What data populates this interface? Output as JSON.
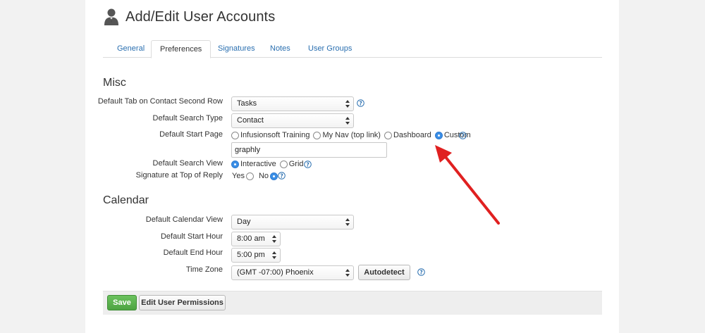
{
  "page": {
    "title": "Add/Edit User Accounts",
    "title_icon": "user-silhouette-icon"
  },
  "tabs": [
    {
      "label": "General",
      "active": false
    },
    {
      "label": "Preferences",
      "active": true
    },
    {
      "label": "Signatures",
      "active": false
    },
    {
      "label": "Notes",
      "active": false
    },
    {
      "label": "User Groups",
      "active": false
    }
  ],
  "misc": {
    "heading": "Misc",
    "default_tab_label": "Default Tab on Contact Second Row",
    "default_tab_value": "Tasks",
    "default_search_type_label": "Default Search Type",
    "default_search_type_value": "Contact",
    "default_start_page_label": "Default Start Page",
    "start_page_options": [
      {
        "label": "Infusionsoft Training",
        "selected": false
      },
      {
        "label": "My Nav (top link)",
        "selected": false
      },
      {
        "label": "Dashboard",
        "selected": false
      },
      {
        "label": "Custom",
        "selected": true
      }
    ],
    "custom_url_value": "graphly",
    "default_search_view_label": "Default Search View",
    "search_view_options": [
      {
        "label": "Interactive",
        "selected": true
      },
      {
        "label": "Grid",
        "selected": false
      }
    ],
    "signature_label": "Signature at Top of Reply",
    "signature_options": [
      {
        "label": "Yes",
        "selected": false
      },
      {
        "label": "No",
        "selected": true
      }
    ]
  },
  "calendar": {
    "heading": "Calendar",
    "view_label": "Default Calendar View",
    "view_value": "Day",
    "start_hour_label": "Default Start Hour",
    "start_hour_value": "8:00 am",
    "end_hour_label": "Default End Hour",
    "end_hour_value": "5:00 pm",
    "timezone_label": "Time Zone",
    "timezone_value": "(GMT -07:00) Phoenix",
    "autodetect_label": "Autodetect"
  },
  "actions": {
    "save_label": "Save",
    "permissions_label": "Edit User Permissions"
  },
  "colors": {
    "link": "#2a6fb0",
    "radio_selected": "#3a8ee6",
    "save_button": "#5cb34f",
    "annotation_arrow": "#e02020"
  }
}
